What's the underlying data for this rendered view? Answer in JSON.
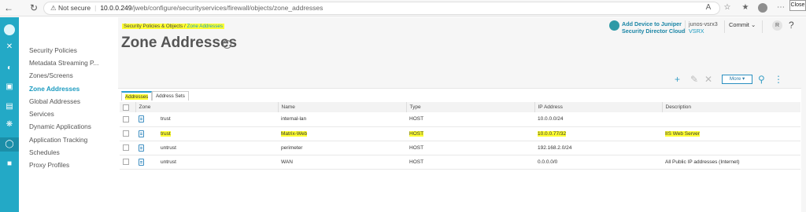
{
  "browser": {
    "not_secure": "Not secure",
    "url_host": "10.0.0.249",
    "url_path": "/jweb/configure/securityservices/firewall/objects/zone_addresses",
    "close_tooltip": "Close"
  },
  "breadcrumb": {
    "parent": "Security Policies & Objects",
    "separator": "/",
    "current": "Zone Addresses"
  },
  "page_title": "Zone Addresses",
  "header": {
    "add_device_line1": "Add Device to Juniper",
    "add_device_line2": "Security Director Cloud",
    "device_name": "junos-vsrx3",
    "device_model": "VSRX",
    "commit_label": "Commit",
    "user_initial": "R"
  },
  "sidebar": {
    "items": [
      {
        "label": "Security Policies"
      },
      {
        "label": "Metadata Streaming P..."
      },
      {
        "label": "Zones/Screens"
      },
      {
        "label": "Zone Addresses"
      },
      {
        "label": "Global Addresses"
      },
      {
        "label": "Services"
      },
      {
        "label": "Dynamic Applications"
      },
      {
        "label": "Application Tracking"
      },
      {
        "label": "Schedules"
      },
      {
        "label": "Proxy Profiles"
      }
    ],
    "active": "Zone Addresses"
  },
  "tabs": [
    {
      "label": "Addresses"
    },
    {
      "label": "Address Sets"
    }
  ],
  "toolbar": {
    "more_label": "More"
  },
  "table": {
    "columns": [
      "Zone",
      "Name",
      "Type",
      "IP Address",
      "Description"
    ],
    "rows": [
      {
        "zone": "trust",
        "name": "internal-lan",
        "type": "HOST",
        "ip": "10.0.0.0/24",
        "description": ""
      },
      {
        "zone": "trust",
        "name": "Matrix-Web",
        "type": "HOST",
        "ip": "10.0.0.77/32",
        "description": "IIS Web Server"
      },
      {
        "zone": "untrust",
        "name": "perimeter",
        "type": "HOST",
        "ip": "192.168.2.0/24",
        "description": ""
      },
      {
        "zone": "untrust",
        "name": "WAN",
        "type": "HOST",
        "ip": "0.0.0.0/0",
        "description": "All Public IP addresses (Internet)"
      }
    ]
  },
  "colors": {
    "accent": "#23a9c6",
    "highlight": "#ffff33",
    "link": "#1c9bc0"
  }
}
